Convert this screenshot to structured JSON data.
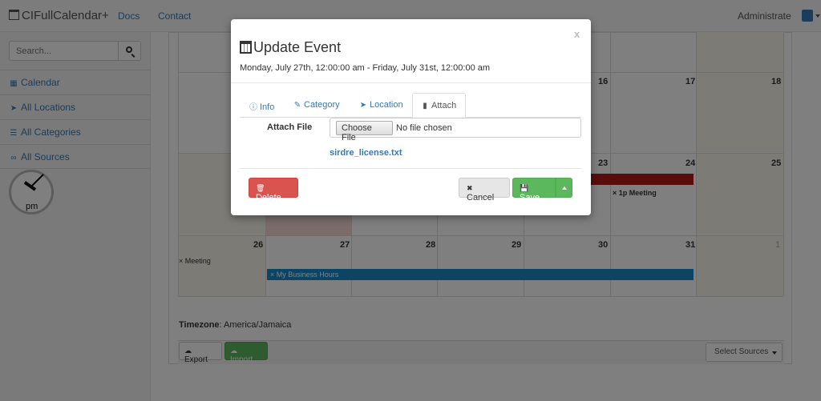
{
  "navbar": {
    "brand": "CIFullCalendar+",
    "docs": "Docs",
    "contact": "Contact",
    "user": "Administrate"
  },
  "sidebar": {
    "search_placeholder": "Search...",
    "items": [
      {
        "label": "Calendar",
        "icon": "calendar-icon"
      },
      {
        "label": "All Locations",
        "icon": "location-arrow-icon"
      },
      {
        "label": "All Categories",
        "icon": "list-icon"
      },
      {
        "label": "All Sources",
        "icon": "link-icon"
      }
    ],
    "clock_label": "pm"
  },
  "calendar": {
    "day_numbers": {
      "d16": "16",
      "d17": "17",
      "d18": "18",
      "d23": "23",
      "d24": "24",
      "d25": "25",
      "d26": "26",
      "d27": "27",
      "d28": "28",
      "d29": "29",
      "d30": "30",
      "d31": "31",
      "d1": "1"
    },
    "events": {
      "meeting_24": "1p Meeting",
      "meeting_26": "Meeting",
      "business_hours": "My Business Hours"
    },
    "timezone_label": "Timezone",
    "timezone_value": "America/Jamaica",
    "export_label": "Export",
    "import_label": "Import",
    "select_sources": "Select Sources"
  },
  "modal": {
    "close": "x",
    "title": "Update Event",
    "subtitle": "Monday, July 27th, 12:00:00 am - Friday, July 31st, 12:00:00 am",
    "tabs": [
      {
        "label": "Info",
        "icon": "info-icon"
      },
      {
        "label": "Category",
        "icon": "brush-icon"
      },
      {
        "label": "Location",
        "icon": "location-arrow-icon"
      },
      {
        "label": "Attach",
        "icon": "file-icon",
        "active": true
      }
    ],
    "attach_label": "Attach File",
    "choose_file": "Choose File",
    "no_file": "No file chosen",
    "attached_file": "sirdre_license.txt",
    "delete_label": "Delete",
    "cancel_label": "Cancel",
    "save_label": "Save"
  },
  "colors": {
    "primary": "#337ab7",
    "danger": "#d9534f",
    "success": "#5cb85c",
    "event_red": "#b41b1b",
    "event_blue": "#1a89c7"
  }
}
